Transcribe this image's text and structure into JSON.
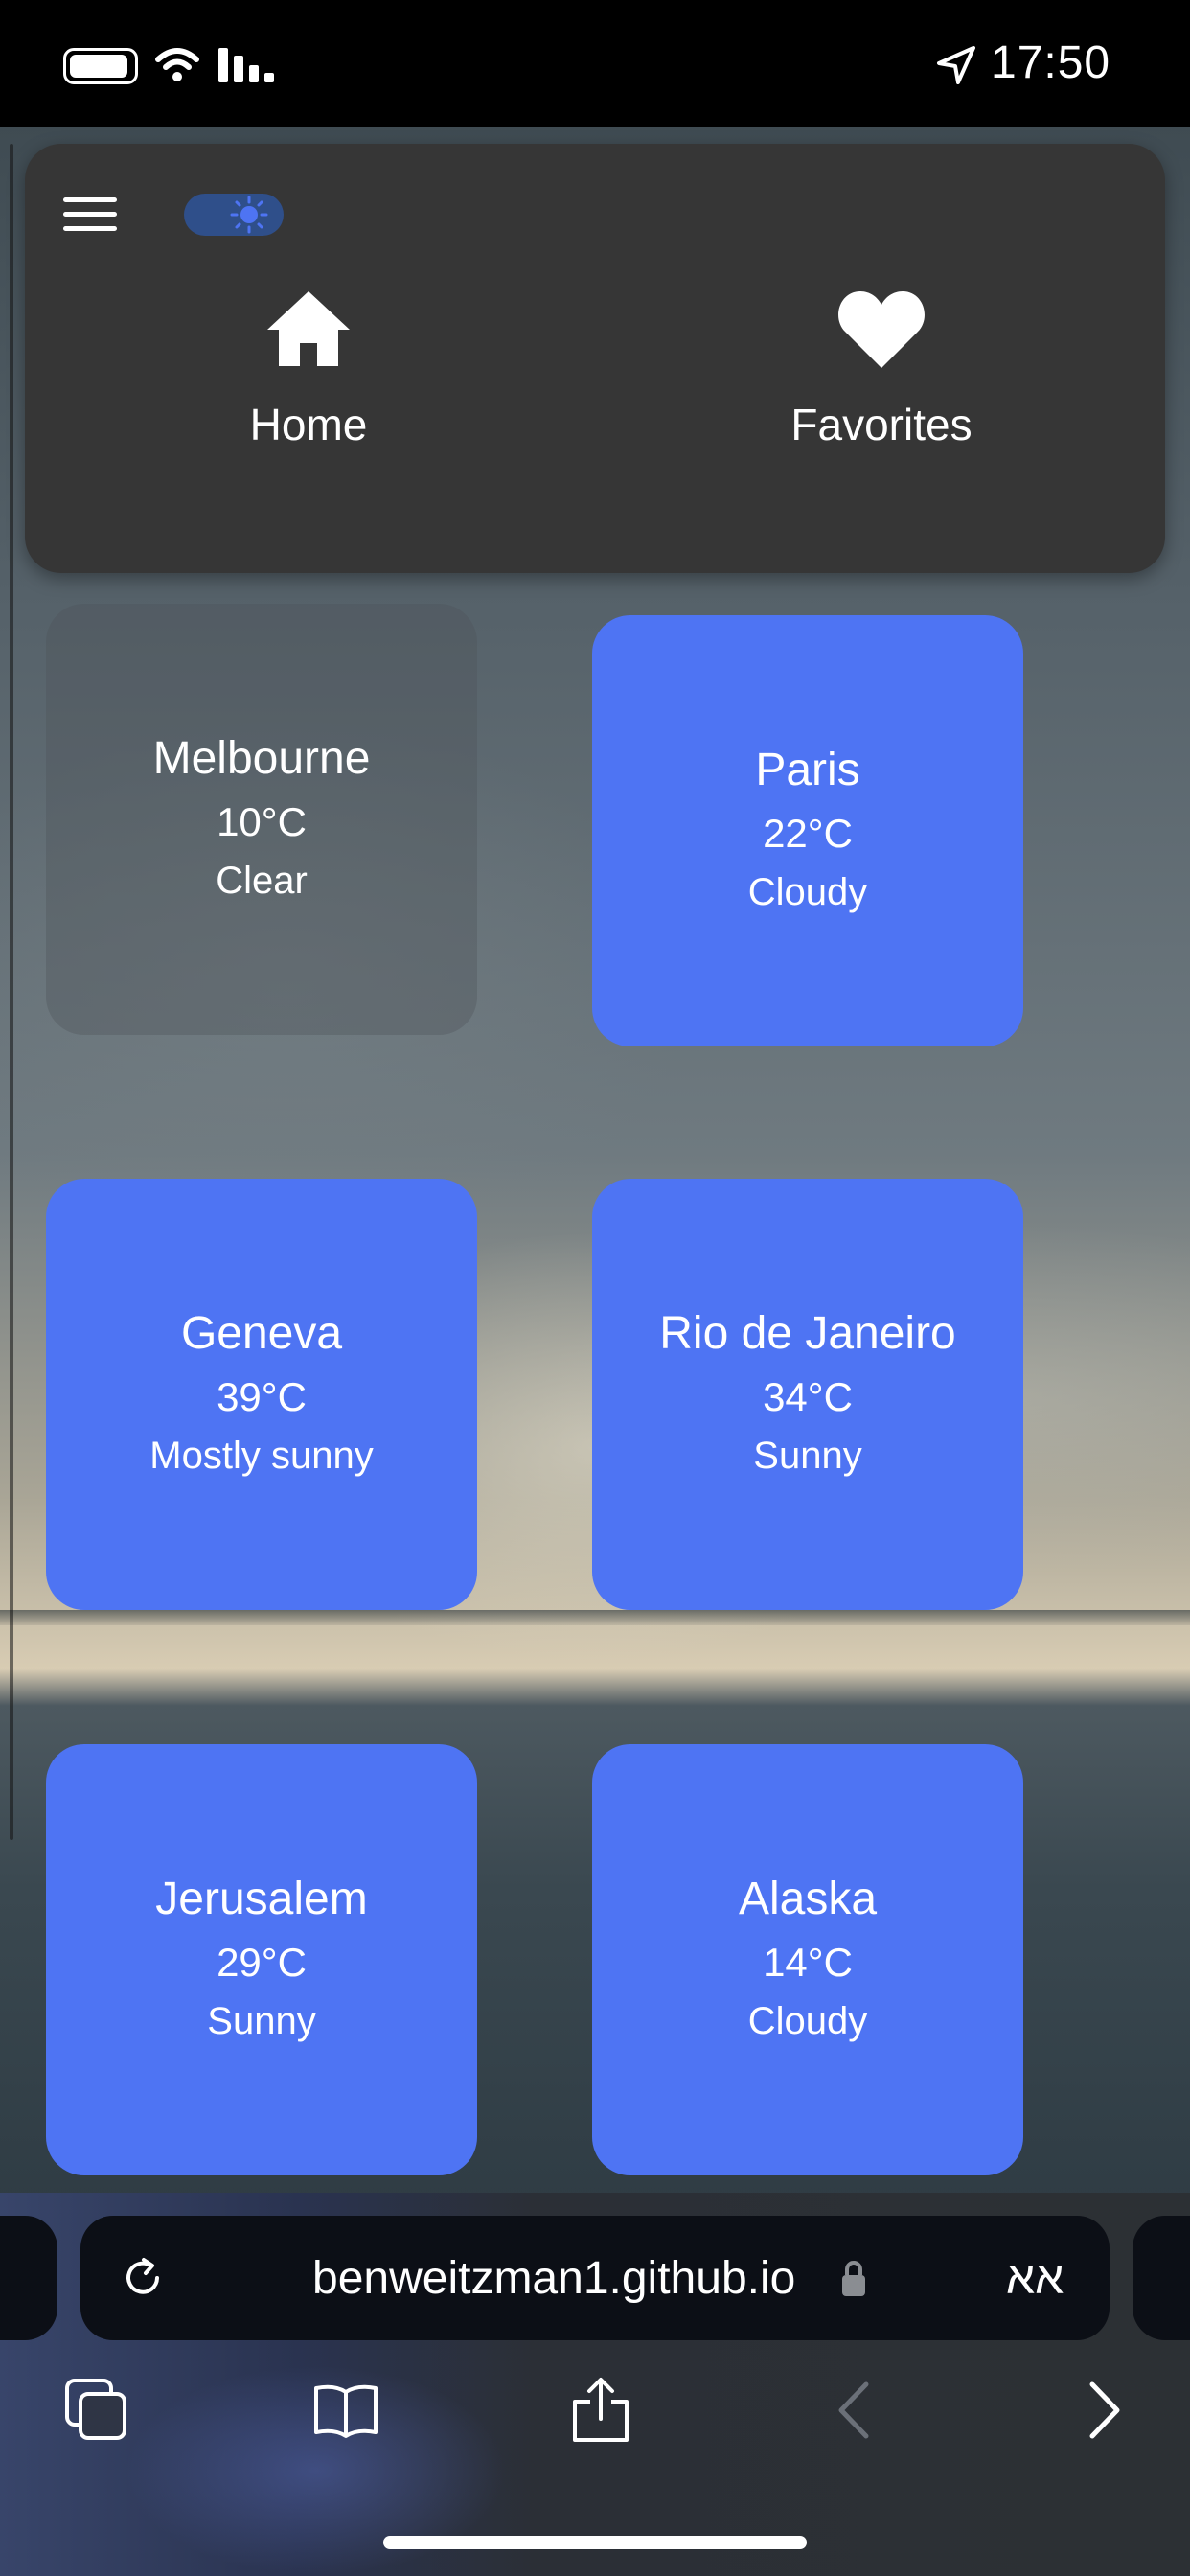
{
  "status_bar": {
    "time": "17:50"
  },
  "header": {
    "nav": [
      {
        "label": "Home",
        "icon": "home-icon"
      },
      {
        "label": "Favorites",
        "icon": "heart-icon"
      }
    ]
  },
  "cities": [
    {
      "name": "Melbourne",
      "temp": "10°C",
      "condition": "Clear"
    },
    {
      "name": "Paris",
      "temp": "22°C",
      "condition": "Cloudy"
    },
    {
      "name": "Geneva",
      "temp": "39°C",
      "condition": "Mostly sunny"
    },
    {
      "name": "Rio de Janeiro",
      "temp": "34°C",
      "condition": "Sunny"
    },
    {
      "name": "Jerusalem",
      "temp": "29°C",
      "condition": "Sunny"
    },
    {
      "name": "Alaska",
      "temp": "14°C",
      "condition": "Cloudy"
    }
  ],
  "browser": {
    "url": "benweitzman1.github.io",
    "reader_label": "אא"
  },
  "colors": {
    "card": "#4e74f3",
    "header": "#363636",
    "toggle": "#2f4f8a"
  }
}
